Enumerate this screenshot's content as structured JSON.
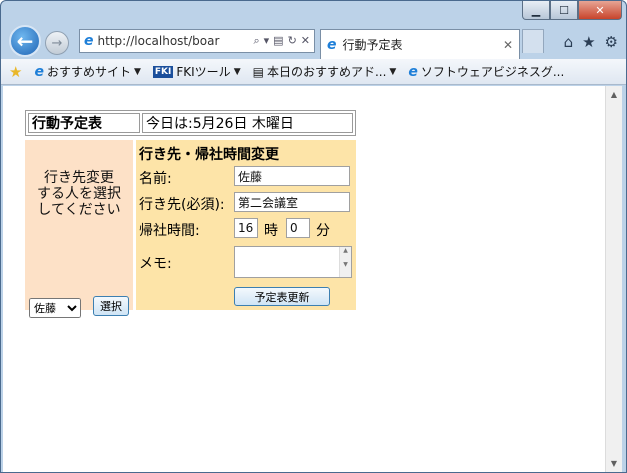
{
  "browser": {
    "address_url": "http://localhost/boar",
    "tab_title": "行動予定表",
    "favorites": [
      {
        "label": "おすすめサイト"
      },
      {
        "label": "FKIツール"
      },
      {
        "label": "本日のおすすめアド..."
      },
      {
        "label": "ソフトウェアビジネスグ..."
      }
    ],
    "fki_badge": "FKI"
  },
  "page": {
    "title": "行動予定表",
    "date_text": "今日は:5月26日 木曜日",
    "left": {
      "prompt_line1": "行き先変更",
      "prompt_line2": "する人を選択",
      "prompt_line3": "してください",
      "select_value": "佐藤",
      "select_button": "選択"
    },
    "right": {
      "section_title": "行き先・帰社時間変更",
      "name_label": "名前:",
      "name_value": "佐藤",
      "dest_label": "行き先(必須):",
      "dest_value": "第二会議室",
      "return_label": "帰社時間:",
      "hour_value": "16",
      "hour_unit": "時",
      "minute_value": "0",
      "minute_unit": "分",
      "memo_label": "メモ:",
      "memo_value": "",
      "update_button": "予定表更新"
    }
  },
  "colors": {
    "left_panel_bg": "#fde1c7",
    "right_panel_bg": "#fde4a8"
  }
}
